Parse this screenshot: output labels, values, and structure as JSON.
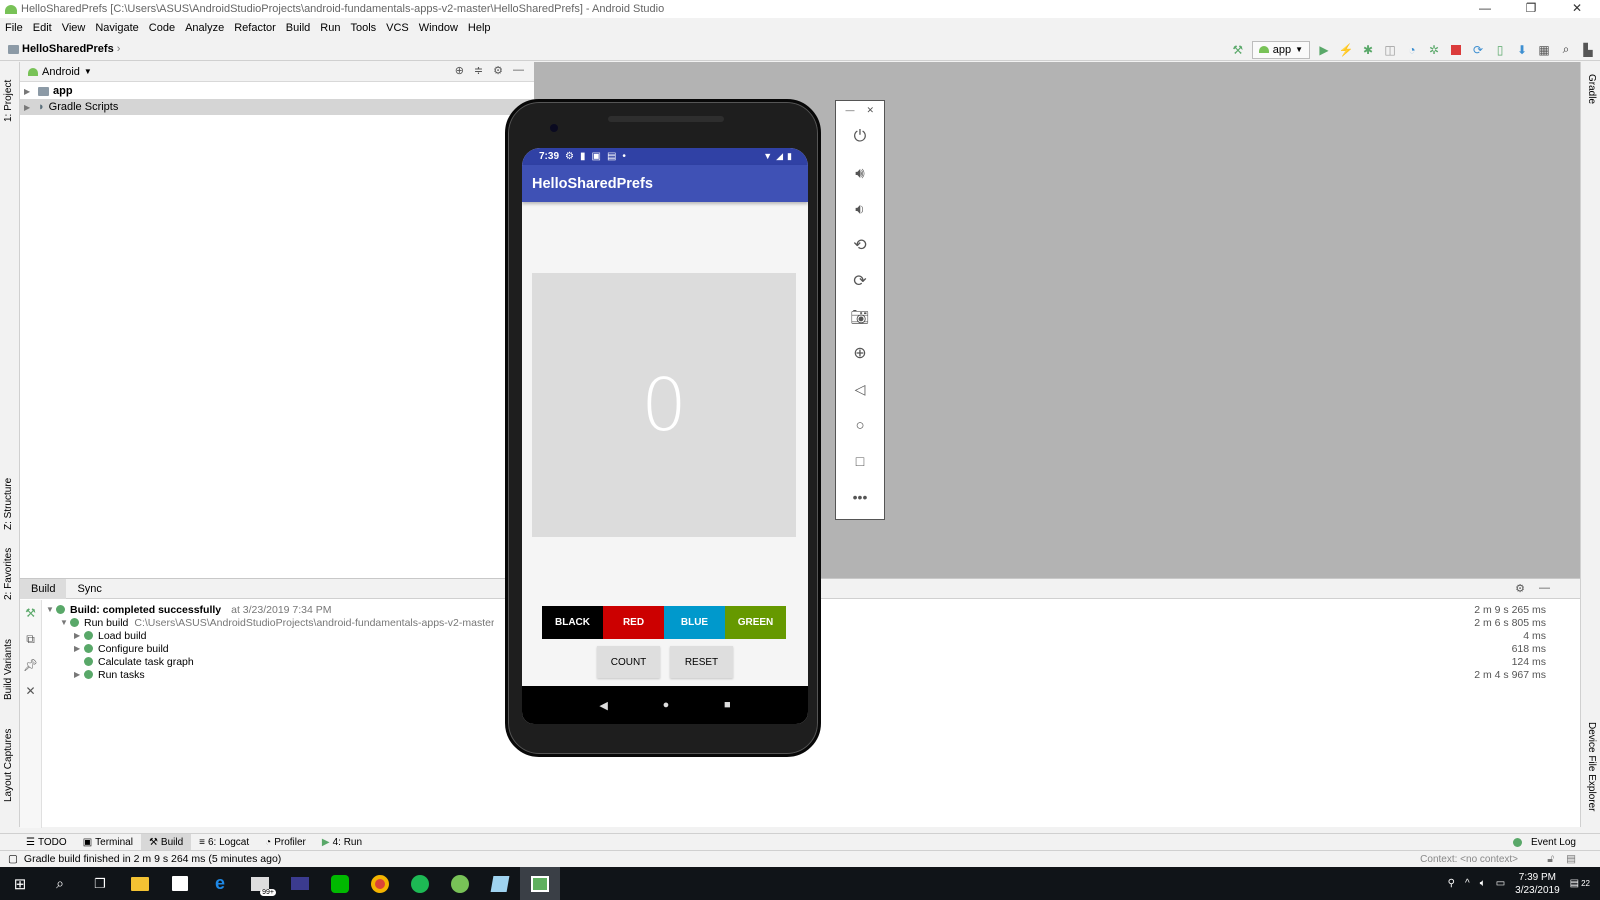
{
  "window": {
    "title": "HelloSharedPrefs [C:\\Users\\ASUS\\AndroidStudioProjects\\android-fundamentals-apps-v2-master\\HelloSharedPrefs] - Android Studio"
  },
  "menu": [
    "File",
    "Edit",
    "View",
    "Navigate",
    "Code",
    "Analyze",
    "Refactor",
    "Build",
    "Run",
    "Tools",
    "VCS",
    "Window",
    "Help"
  ],
  "breadcrumb": "HelloSharedPrefs",
  "run_config": "app",
  "project_panel": {
    "view_selector": "Android",
    "items": [
      "app",
      "Gradle Scripts"
    ]
  },
  "left_strip": [
    "1: Project",
    "Z: Structure",
    "2: Favorites",
    "Build Variants",
    "Layout Captures"
  ],
  "right_strip": [
    "Gradle",
    "Device File Explorer"
  ],
  "build": {
    "tabs": [
      "Build",
      "Sync"
    ],
    "rows": [
      {
        "label": "Build: completed successfully",
        "detail": "at 3/23/2019 7:34 PM",
        "time": "2 m 9 s 265 ms"
      },
      {
        "label": "Run build",
        "detail": "C:\\Users\\ASUS\\AndroidStudioProjects\\android-fundamentals-apps-v2-master\\Hell",
        "time": "2 m 6 s 805 ms"
      },
      {
        "label": "Load build",
        "detail": "",
        "time": "4 ms"
      },
      {
        "label": "Configure build",
        "detail": "",
        "time": "618 ms"
      },
      {
        "label": "Calculate task graph",
        "detail": "",
        "time": "124 ms"
      },
      {
        "label": "Run tasks",
        "detail": "",
        "time": "2 m 4 s 967 ms"
      }
    ]
  },
  "bottom_tabs": [
    "TODO",
    "Terminal",
    "Build",
    "6: Logcat",
    "Profiler",
    "4: Run"
  ],
  "event_log": "Event Log",
  "status": {
    "message": "Gradle build finished in 2 m 9 s 264 ms (5 minutes ago)",
    "context": "Context: <no context>"
  },
  "phone": {
    "time": "7:39",
    "app_title": "HelloSharedPrefs",
    "count": "0",
    "color_buttons": [
      {
        "label": "BLACK",
        "color": "#000000"
      },
      {
        "label": "RED",
        "color": "#cc0000"
      },
      {
        "label": "BLUE",
        "color": "#0099cc"
      },
      {
        "label": "GREEN",
        "color": "#669900"
      }
    ],
    "count_button": "COUNT",
    "reset_button": "RESET"
  },
  "taskbar": {
    "time": "7:39 PM",
    "date": "3/23/2019",
    "notifications": "22",
    "badge": "99+"
  },
  "colors": {
    "app_bar": "#3f51b5",
    "status_bar": "#3041a5",
    "count_bg": "#dcdcdc"
  }
}
